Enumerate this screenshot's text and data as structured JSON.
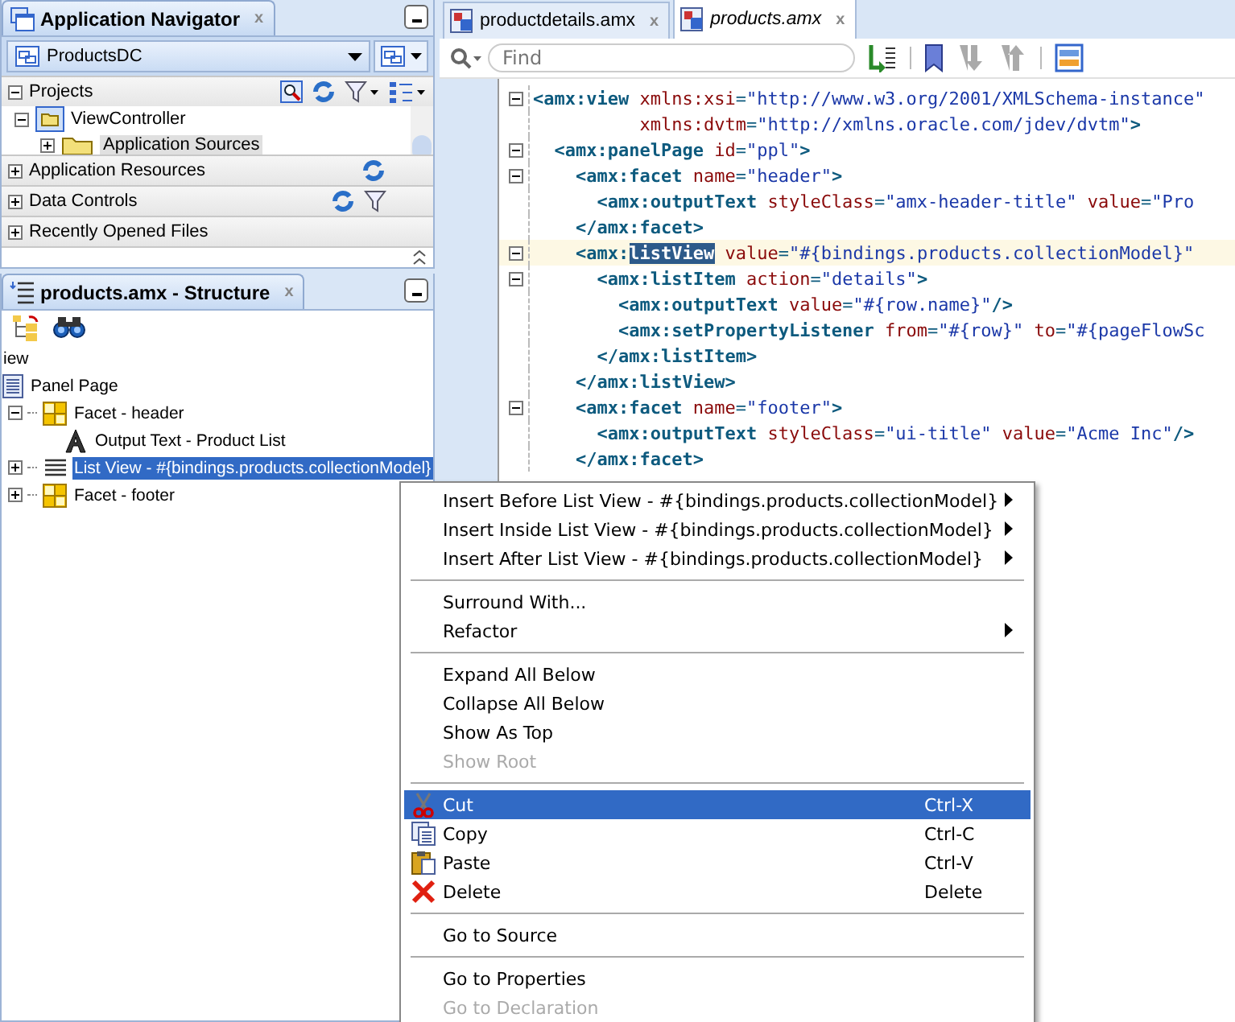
{
  "navigator": {
    "title": "Application Navigator",
    "close": "x",
    "application": "ProductsDC",
    "sections": [
      {
        "label": "Projects",
        "expanded": true,
        "tree": [
          {
            "label": "ViewController",
            "expanded": true,
            "children": [
              {
                "label": "Application Sources",
                "expanded": false,
                "selected": true
              }
            ]
          }
        ]
      },
      {
        "label": "Application Resources",
        "expanded": false
      },
      {
        "label": "Data Controls",
        "expanded": false
      },
      {
        "label": "Recently Opened Files",
        "expanded": false
      }
    ]
  },
  "structure": {
    "title": "products.amx - Structure",
    "close": "x",
    "tree": [
      {
        "label": "iew",
        "selected": false,
        "children": [
          {
            "label": "Panel Page",
            "kind": "page",
            "selected": false,
            "children": [
              {
                "label": "Facet - header",
                "kind": "facet",
                "expanded": true,
                "selected": false,
                "children": [
                  {
                    "label": "Output Text - Product List",
                    "kind": "text",
                    "selected": false
                  }
                ]
              },
              {
                "label": "List View - #{bindings.products.collectionModel}",
                "kind": "list",
                "expanded": false,
                "selected": true
              },
              {
                "label": "Facet - footer",
                "kind": "facet",
                "expanded": false,
                "selected": false
              }
            ]
          }
        ]
      }
    ]
  },
  "editor": {
    "tabs": [
      {
        "label": "productdetails.amx",
        "selected": false,
        "close": "x"
      },
      {
        "label": "products.amx",
        "selected": true,
        "close": "x"
      }
    ],
    "search": {
      "placeholder": "Find"
    },
    "lines": [
      {
        "fold": true,
        "selected": false,
        "tokens": [
          {
            "kind": "tag",
            "text": "<amx:view"
          },
          {
            "kind": "attr",
            "text": " xmlns:xsi"
          },
          {
            "kind": "punct",
            "text": "="
          },
          {
            "kind": "value",
            "text": "\"http://www.w3.org/2001/XMLSchema-instance\""
          }
        ]
      },
      {
        "fold": false,
        "selected": false,
        "tokens": [
          {
            "kind": "attr",
            "text": "          xmlns:dvtm"
          },
          {
            "kind": "punct",
            "text": "="
          },
          {
            "kind": "value",
            "text": "\"http://xmlns.oracle.com/jdev/dvtm\""
          },
          {
            "kind": "tag",
            "text": ">"
          }
        ]
      },
      {
        "fold": true,
        "selected": false,
        "tokens": [
          {
            "kind": "tag",
            "text": "  <amx:panelPage"
          },
          {
            "kind": "attr",
            "text": " id"
          },
          {
            "kind": "punct",
            "text": "="
          },
          {
            "kind": "value",
            "text": "\"ppl\""
          },
          {
            "kind": "tag",
            "text": ">"
          }
        ]
      },
      {
        "fold": true,
        "selected": false,
        "tokens": [
          {
            "kind": "tag",
            "text": "    <amx:facet"
          },
          {
            "kind": "attr",
            "text": " name"
          },
          {
            "kind": "punct",
            "text": "="
          },
          {
            "kind": "value",
            "text": "\"header\""
          },
          {
            "kind": "tag",
            "text": ">"
          }
        ]
      },
      {
        "fold": false,
        "selected": false,
        "tokens": [
          {
            "kind": "tag",
            "text": "      <amx:outputText"
          },
          {
            "kind": "attr",
            "text": " styleClass"
          },
          {
            "kind": "punct",
            "text": "="
          },
          {
            "kind": "value",
            "text": "\"amx-header-title\""
          },
          {
            "kind": "attr",
            "text": " value"
          },
          {
            "kind": "punct",
            "text": "="
          },
          {
            "kind": "value",
            "text": "\"Pro"
          }
        ]
      },
      {
        "fold": false,
        "selected": false,
        "tokens": [
          {
            "kind": "tag",
            "text": "    </amx:facet>"
          }
        ]
      },
      {
        "fold": true,
        "selected": true,
        "tokens": [
          {
            "kind": "tag",
            "text": "    <amx:"
          },
          {
            "kind": "match",
            "text": "listView"
          },
          {
            "kind": "attr",
            "text": " value"
          },
          {
            "kind": "punct",
            "text": "="
          },
          {
            "kind": "value",
            "text": "\"#{bindings.products.collectionModel}\""
          }
        ]
      },
      {
        "fold": true,
        "selected": false,
        "tokens": [
          {
            "kind": "tag",
            "text": "      <amx:listItem"
          },
          {
            "kind": "attr",
            "text": " action"
          },
          {
            "kind": "punct",
            "text": "="
          },
          {
            "kind": "value",
            "text": "\"details\""
          },
          {
            "kind": "tag",
            "text": ">"
          }
        ]
      },
      {
        "fold": false,
        "selected": false,
        "tokens": [
          {
            "kind": "tag",
            "text": "        <amx:outputText"
          },
          {
            "kind": "attr",
            "text": " value"
          },
          {
            "kind": "punct",
            "text": "="
          },
          {
            "kind": "value",
            "text": "\"#{row.name}\""
          },
          {
            "kind": "tag",
            "text": "/>"
          }
        ]
      },
      {
        "fold": false,
        "selected": false,
        "tokens": [
          {
            "kind": "tag",
            "text": "        <amx:setPropertyListener"
          },
          {
            "kind": "attr",
            "text": " from"
          },
          {
            "kind": "punct",
            "text": "="
          },
          {
            "kind": "value",
            "text": "\"#{row}\""
          },
          {
            "kind": "attr",
            "text": " to"
          },
          {
            "kind": "punct",
            "text": "="
          },
          {
            "kind": "value",
            "text": "\"#{pageFlowSc"
          }
        ]
      },
      {
        "fold": false,
        "selected": false,
        "tokens": [
          {
            "kind": "tag",
            "text": "      </amx:listItem>"
          }
        ]
      },
      {
        "fold": false,
        "selected": false,
        "tokens": [
          {
            "kind": "tag",
            "text": "    </amx:listView>"
          }
        ]
      },
      {
        "fold": true,
        "selected": false,
        "tokens": [
          {
            "kind": "tag",
            "text": "    <amx:facet"
          },
          {
            "kind": "attr",
            "text": " name"
          },
          {
            "kind": "punct",
            "text": "="
          },
          {
            "kind": "value",
            "text": "\"footer\""
          },
          {
            "kind": "tag",
            "text": ">"
          }
        ]
      },
      {
        "fold": false,
        "selected": false,
        "tokens": [
          {
            "kind": "tag",
            "text": "      <amx:outputText"
          },
          {
            "kind": "attr",
            "text": " styleClass"
          },
          {
            "kind": "punct",
            "text": "="
          },
          {
            "kind": "value",
            "text": "\"ui-title\""
          },
          {
            "kind": "attr",
            "text": " value"
          },
          {
            "kind": "punct",
            "text": "="
          },
          {
            "kind": "value",
            "text": "\"Acme Inc\""
          },
          {
            "kind": "tag",
            "text": "/>"
          }
        ]
      },
      {
        "fold": false,
        "selected": false,
        "tokens": [
          {
            "kind": "tag",
            "text": "    </amx:facet>"
          }
        ]
      }
    ]
  },
  "context_menu": {
    "groups": [
      {
        "kind": "plain",
        "items": [
          {
            "label": "Insert Before List View - #{bindings.products.collectionModel}",
            "submenu": true,
            "disabled": false,
            "selected": false
          },
          {
            "label": "Insert Inside List View - #{bindings.products.collectionModel}",
            "submenu": true,
            "disabled": false,
            "selected": false
          },
          {
            "label": "Insert After List View - #{bindings.products.collectionModel}",
            "submenu": true,
            "disabled": false,
            "selected": false
          }
        ]
      },
      {
        "kind": "plain",
        "items": [
          {
            "label": "Surround With...",
            "submenu": false,
            "disabled": false,
            "selected": false
          },
          {
            "label": "Refactor",
            "submenu": true,
            "disabled": false,
            "selected": false
          }
        ]
      },
      {
        "kind": "plain",
        "items": [
          {
            "label": "Expand All Below",
            "submenu": false,
            "disabled": false,
            "selected": false
          },
          {
            "label": "Collapse All Below",
            "submenu": false,
            "disabled": false,
            "selected": false
          },
          {
            "label": "Show As Top",
            "submenu": false,
            "disabled": false,
            "selected": false
          },
          {
            "label": "Show Root",
            "submenu": false,
            "disabled": true,
            "selected": false
          }
        ]
      },
      {
        "kind": "edit",
        "items": [
          {
            "label": "Cut",
            "shortcut": "Ctrl-X",
            "submenu": false,
            "disabled": false,
            "selected": true
          },
          {
            "label": "Copy",
            "shortcut": "Ctrl-C",
            "submenu": false,
            "disabled": false,
            "selected": false
          },
          {
            "label": "Paste",
            "shortcut": "Ctrl-V",
            "submenu": false,
            "disabled": false,
            "selected": false
          },
          {
            "label": "Delete",
            "shortcut": "Delete",
            "submenu": false,
            "disabled": false,
            "selected": false
          }
        ]
      },
      {
        "kind": "plain",
        "items": [
          {
            "label": "Go to Source",
            "submenu": false,
            "disabled": false,
            "selected": false
          }
        ]
      },
      {
        "kind": "plain",
        "items": [
          {
            "label": "Go to Properties",
            "submenu": false,
            "disabled": false,
            "selected": false
          },
          {
            "label": "Go to Declaration",
            "submenu": false,
            "disabled": true,
            "selected": false
          }
        ]
      }
    ]
  }
}
